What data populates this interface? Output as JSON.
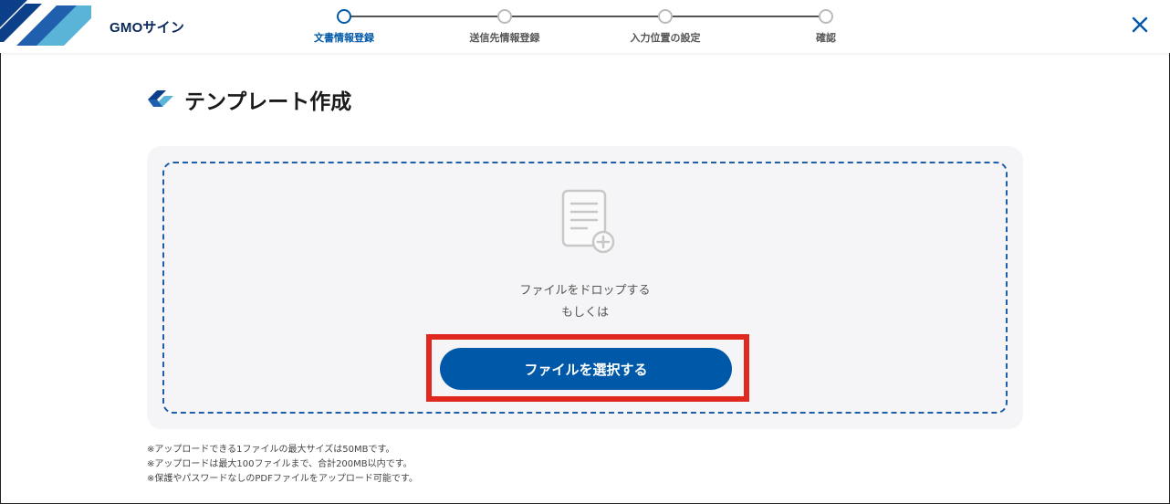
{
  "header": {
    "brand": "GMOサイン",
    "close_icon": "close-icon"
  },
  "steps": [
    {
      "label": "文書情報登録",
      "active": true
    },
    {
      "label": "送信先情報登録",
      "active": false
    },
    {
      "label": "入力位置の設定",
      "active": false
    },
    {
      "label": "確認",
      "active": false
    }
  ],
  "main": {
    "title": "テンプレート作成",
    "title_icon": "gmo-sign-logo-icon"
  },
  "upload": {
    "icon": "document-add-icon",
    "drop_text": "ファイルをドロップする",
    "or_text": "もしくは",
    "select_button": "ファイルを選択する"
  },
  "notes": [
    "※アップロードできる1ファイルの最大サイズは50MBです。",
    "※アップロードは最大100ファイルまで、合計200MB以内です。",
    "※保護やパスワードなしのPDFファイルをアップロード可能です。"
  ],
  "colors": {
    "accent": "#0058a8",
    "highlight": "#e0281f",
    "panel_bg": "#f5f5f7"
  }
}
